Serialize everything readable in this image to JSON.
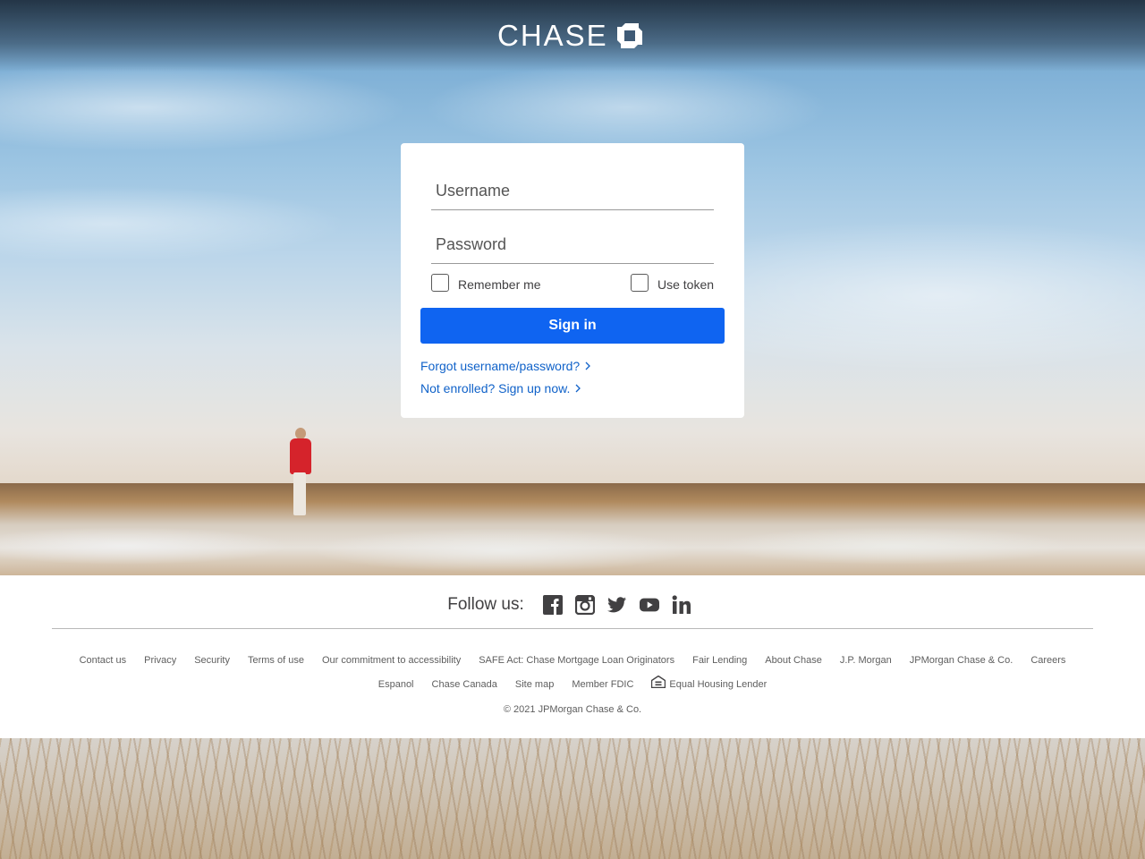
{
  "brand": {
    "name": "CHASE"
  },
  "login": {
    "username_placeholder": "Username",
    "password_placeholder": "Password",
    "remember_label": "Remember me",
    "token_label": "Use token",
    "signin_label": "Sign in",
    "forgot_link": "Forgot username/password?",
    "enroll_link": "Not enrolled? Sign up now."
  },
  "footer": {
    "follow_label": "Follow us:",
    "social": [
      "facebook-icon",
      "instagram-icon",
      "twitter-icon",
      "youtube-icon",
      "linkedin-icon"
    ],
    "links_row1": [
      "Contact us",
      "Privacy",
      "Security",
      "Terms of use",
      "Our commitment to accessibility",
      "SAFE Act: Chase Mortgage Loan Originators",
      "Fair Lending",
      "About Chase",
      "J.P. Morgan",
      "JPMorgan Chase & Co.",
      "Careers"
    ],
    "links_row2": [
      "Espanol",
      "Chase Canada",
      "Site map",
      "Member FDIC",
      "Equal Housing Lender"
    ],
    "copyright": "© 2021 JPMorgan Chase & Co."
  },
  "colors": {
    "primary_button": "#0f64f1",
    "link": "#1062c9",
    "text": "#414042"
  }
}
